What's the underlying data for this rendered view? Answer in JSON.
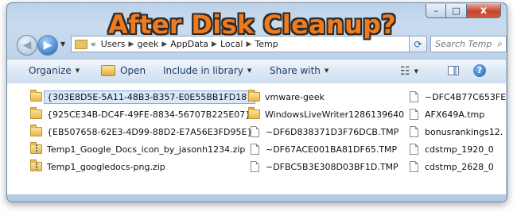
{
  "overlay": {
    "title": "After Disk Cleanup?"
  },
  "window": {
    "controls": {
      "minimize": "–",
      "maximize": "□",
      "close": "x"
    }
  },
  "nav": {
    "back_icon": "back-arrow-icon",
    "forward_icon": "forward-arrow-icon",
    "address_prefix": "«",
    "breadcrumbs": [
      "Users",
      "geek",
      "AppData",
      "Local",
      "Temp"
    ],
    "separator": "▶",
    "search_placeholder": "Search Temp",
    "refresh_icon": "⟳"
  },
  "commands": {
    "organize": "Organize",
    "open": "Open",
    "include_in_library": "Include in library",
    "share_with": "Share with",
    "caret": "▼",
    "help": "?"
  },
  "files": {
    "column1": [
      {
        "name": "{303E8D5E-5A11-48B3-B357-E0E55BB1FD18}",
        "type": "folder",
        "selected": true
      },
      {
        "name": "{925CE34B-DC4F-49FE-8834-56707B225E07}",
        "type": "folder"
      },
      {
        "name": "{EB507658-62E3-4D99-88D2-E7A56E3FD95E}",
        "type": "folder"
      },
      {
        "name": "Temp1_Google_Docs_icon_by_jasonh1234.zip",
        "type": "zip"
      },
      {
        "name": "Temp1_googledocs-png.zip",
        "type": "zip"
      }
    ],
    "column2": [
      {
        "name": "vmware-geek",
        "type": "folder"
      },
      {
        "name": "WindowsLiveWriter1286139640",
        "type": "folder"
      },
      {
        "name": "~DF6D838371D3F76DCB.TMP",
        "type": "file"
      },
      {
        "name": "~DF67ACE001BA81DF65.TMP",
        "type": "file"
      },
      {
        "name": "~DFBC5B3E308D03BF1D.TMP",
        "type": "file"
      }
    ],
    "column3": [
      {
        "name": "~DFC4B77C653FE",
        "type": "file"
      },
      {
        "name": "AFX649A.tmp",
        "type": "file"
      },
      {
        "name": "bonusrankings12.",
        "type": "file"
      },
      {
        "name": "cdstmp_1920_0",
        "type": "file"
      },
      {
        "name": "cdstmp_2628_0",
        "type": "file"
      }
    ]
  }
}
